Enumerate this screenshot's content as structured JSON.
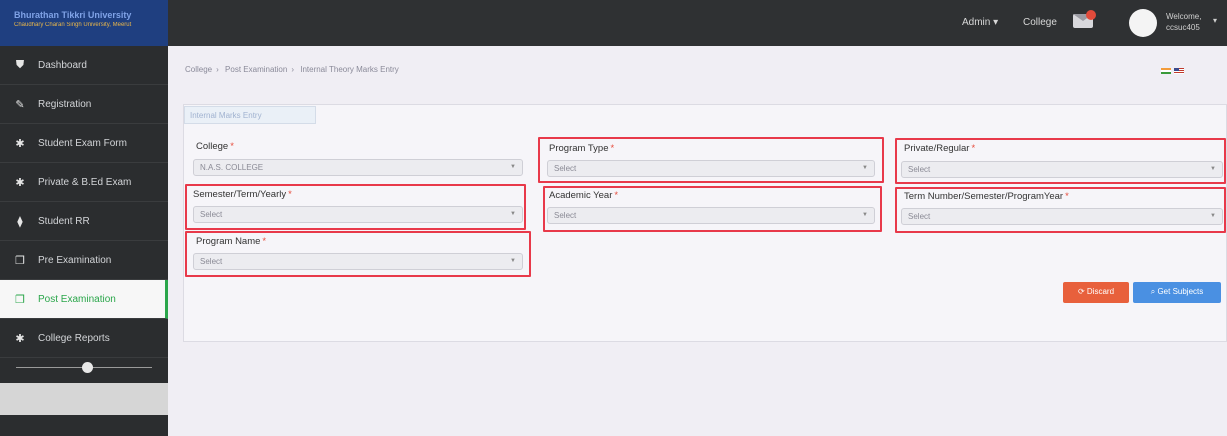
{
  "brand": {
    "line1": "Bhurathan Tikkri University",
    "line2": "Chaudhary Charan Singh University, Meerut"
  },
  "topbar": {
    "admin_label": "Admin",
    "college_label": "College",
    "welcome": "Welcome,",
    "username": "ccsuc405"
  },
  "sidebar": {
    "items": [
      {
        "label": "Dashboard",
        "icon": "shield-icon"
      },
      {
        "label": "Registration",
        "icon": "edit-icon"
      },
      {
        "label": "Student Exam Form",
        "icon": "asterisk-icon"
      },
      {
        "label": "Private & B.Ed Exam",
        "icon": "asterisk-icon"
      },
      {
        "label": "Student RR",
        "icon": "map-marker-icon"
      },
      {
        "label": "Pre Examination",
        "icon": "copy-icon"
      },
      {
        "label": "Post Examination",
        "icon": "copy-icon"
      },
      {
        "label": "College Reports",
        "icon": "asterisk-icon"
      }
    ]
  },
  "breadcrumb": [
    "College",
    "Post Examination",
    "Internal Theory Marks Entry"
  ],
  "panel": {
    "title": "Internal Marks Entry"
  },
  "form": {
    "college": {
      "label": "College",
      "value": "N.A.S. COLLEGE"
    },
    "program_type": {
      "label": "Program Type",
      "value": "Select"
    },
    "private_regular": {
      "label": "Private/Regular",
      "value": "Select"
    },
    "semester": {
      "label": "Semester/Term/Yearly",
      "value": "Select"
    },
    "academic_year": {
      "label": "Academic Year",
      "value": "Select"
    },
    "term_number": {
      "label": "Term Number/Semester/ProgramYear",
      "value": "Select"
    },
    "program_name": {
      "label": "Program Name",
      "value": "Select"
    }
  },
  "buttons": {
    "discard": "Discard",
    "get_subjects": "Get Subjects"
  },
  "colors": {
    "accent_green": "#2aa64a",
    "highlight_red": "#e8394a",
    "discard": "#e8603c",
    "primary": "#4a90e2"
  }
}
